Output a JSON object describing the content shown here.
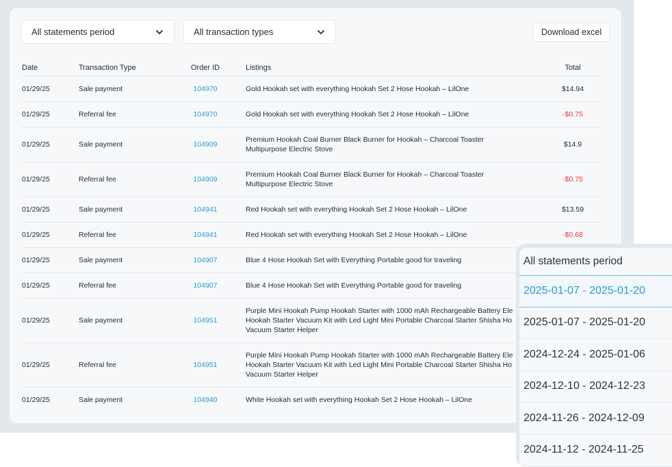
{
  "filters": {
    "period_label": "All statements period",
    "types_label": "All transaction types",
    "download_label": "Download excel"
  },
  "table": {
    "headers": {
      "date": "Date",
      "type": "Transaction Type",
      "order": "Order ID",
      "listings": "Listings",
      "total": "Total"
    },
    "rows": [
      {
        "date": "01/29/25",
        "type": "Sale payment",
        "order": "104970",
        "listing_1": "Gold Hookah set with everything Hookah Set 2 Hose Hookah – LilOne",
        "listing_2": "",
        "listing_3": "",
        "total": "$14.94"
      },
      {
        "date": "01/29/25",
        "type": "Referral fee",
        "order": "104970",
        "listing_1": "Gold Hookah set with everything Hookah Set 2 Hose Hookah – LilOne",
        "listing_2": "",
        "listing_3": "",
        "total": "-$0.75"
      },
      {
        "date": "01/29/25",
        "type": "Sale payment",
        "order": "104909",
        "listing_1": "Premium Hookah Coal Burner Black Burner for Hookah – Charcoal Toaster",
        "listing_2": "Multipurpose Electric Stove",
        "listing_3": "",
        "total": "$14.9"
      },
      {
        "date": "01/29/25",
        "type": "Referral fee",
        "order": "104909",
        "listing_1": "Premium Hookah Coal Burner Black Burner for Hookah – Charcoal Toaster",
        "listing_2": "Multipurpose Electric Stove",
        "listing_3": "",
        "total": "-$0.75"
      },
      {
        "date": "01/29/25",
        "type": "Sale payment",
        "order": "104941",
        "listing_1": "Red Hookah set with everything Hookah Set 2 Hose Hookah – LilOne",
        "listing_2": "",
        "listing_3": "",
        "total": "$13.59"
      },
      {
        "date": "01/29/25",
        "type": "Referral fee",
        "order": "104941",
        "listing_1": "Red Hookah set with everything Hookah Set 2 Hose Hookah – LilOne",
        "listing_2": "",
        "listing_3": "",
        "total": "-$0.68"
      },
      {
        "date": "01/29/25",
        "type": "Sale payment",
        "order": "104907",
        "listing_1": "Blue 4 Hose Hookah Set with Everything Portable good for traveling",
        "listing_2": "",
        "listing_3": "",
        "total": ""
      },
      {
        "date": "01/29/25",
        "type": "Referral fee",
        "order": "104907",
        "listing_1": "Blue 4 Hose Hookah Set with Everything Portable good for traveling",
        "listing_2": "",
        "listing_3": "",
        "total": ""
      },
      {
        "date": "01/29/25",
        "type": "Sale payment",
        "order": "104951",
        "listing_1": "Purple Mini Hookah Pump Hookah Starter with 1000 mAh Rechargeable Battery Ele",
        "listing_2": "Hookah Starter Vacuum Kit with Led Light Mini Portable Charcoal Starter Shisha Ho",
        "listing_3": "Vacuum Starter Helper",
        "total": ""
      },
      {
        "date": "01/29/25",
        "type": "Referral fee",
        "order": "104951",
        "listing_1": "Purple Mini Hookah Pump Hookah Starter with 1000 mAh Rechargeable Battery Ele",
        "listing_2": "Hookah Starter Vacuum Kit with Led Light Mini Portable Charcoal Starter Shisha Ho",
        "listing_3": "Vacuum Starter Helper",
        "total": ""
      },
      {
        "date": "01/29/25",
        "type": "Sale payment",
        "order": "104940",
        "listing_1": "White Hookah set with everything Hookah Set 2 Hose Hookah – LilOne",
        "listing_2": "",
        "listing_3": "",
        "total": ""
      }
    ]
  },
  "period_dropdown": {
    "header": "All statements period",
    "options": [
      "2025-01-07 - 2025-01-20",
      "2025-01-07 - 2025-01-20",
      "2024-12-24 - 2025-01-06",
      "2024-12-10 - 2024-12-23",
      "2024-11-26 - 2024-12-09",
      "2024-11-12 - 2024-11-25"
    ],
    "selected_index": 0
  },
  "colors": {
    "link": "#2a9bd3",
    "negative": "#e23b3b",
    "panel": "#f6f8fa",
    "frame": "#e3e8ec"
  }
}
